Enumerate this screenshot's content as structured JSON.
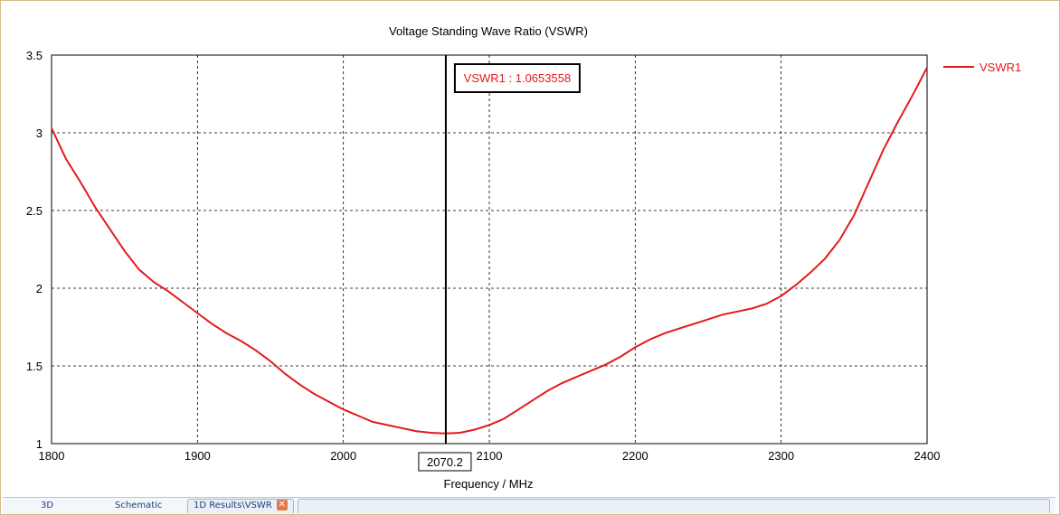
{
  "chart_data": {
    "type": "line",
    "title": "Voltage Standing Wave Ratio (VSWR)",
    "xlabel": "Frequency / MHz",
    "ylabel": "",
    "xlim": [
      1800,
      2400
    ],
    "ylim": [
      1,
      3.5
    ],
    "xticks": [
      "1800",
      "1900",
      "2000",
      "2100",
      "2200",
      "2300",
      "2400"
    ],
    "yticks": [
      "1",
      "1.5",
      "2",
      "2.5",
      "3",
      "3.5"
    ],
    "grid": true,
    "legend_position": "right",
    "series": [
      {
        "name": "VSWR1",
        "color": "#e31a1c",
        "x": [
          1800,
          1810,
          1820,
          1830,
          1840,
          1850,
          1860,
          1870,
          1880,
          1890,
          1900,
          1910,
          1920,
          1930,
          1940,
          1950,
          1960,
          1970,
          1980,
          1990,
          2000,
          2010,
          2020,
          2030,
          2040,
          2050,
          2060,
          2070,
          2080,
          2090,
          2100,
          2110,
          2120,
          2130,
          2140,
          2150,
          2160,
          2170,
          2180,
          2190,
          2200,
          2210,
          2220,
          2230,
          2240,
          2250,
          2260,
          2270,
          2280,
          2290,
          2300,
          2310,
          2320,
          2330,
          2340,
          2350,
          2360,
          2370,
          2380,
          2390,
          2400
        ],
        "y": [
          3.03,
          2.83,
          2.68,
          2.52,
          2.38,
          2.24,
          2.12,
          2.04,
          1.98,
          1.91,
          1.84,
          1.77,
          1.71,
          1.66,
          1.6,
          1.53,
          1.45,
          1.38,
          1.32,
          1.27,
          1.22,
          1.18,
          1.14,
          1.12,
          1.1,
          1.08,
          1.07,
          1.065,
          1.07,
          1.09,
          1.12,
          1.16,
          1.22,
          1.28,
          1.34,
          1.39,
          1.43,
          1.47,
          1.51,
          1.56,
          1.62,
          1.67,
          1.71,
          1.74,
          1.77,
          1.8,
          1.83,
          1.85,
          1.87,
          1.9,
          1.95,
          2.02,
          2.1,
          2.19,
          2.31,
          2.47,
          2.68,
          2.89,
          3.07,
          3.24,
          3.42
        ]
      }
    ],
    "marker": {
      "x": 2070.2,
      "x_label": "2070.2",
      "readout": "VSWR1 : 1.0653558"
    }
  },
  "tabs": [
    {
      "label": "3D"
    },
    {
      "label": "Schematic"
    },
    {
      "label": "1D Results\\VSWR"
    }
  ]
}
